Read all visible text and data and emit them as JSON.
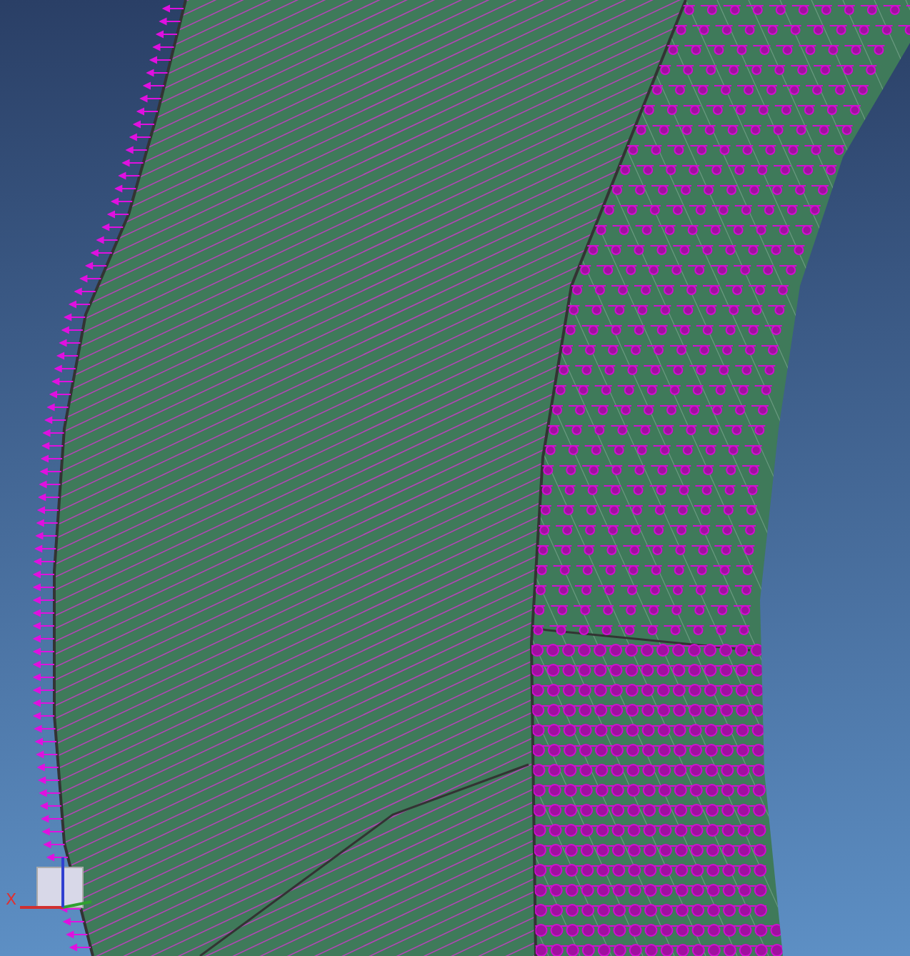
{
  "viewport": {
    "triad": {
      "x_label": "X"
    }
  }
}
